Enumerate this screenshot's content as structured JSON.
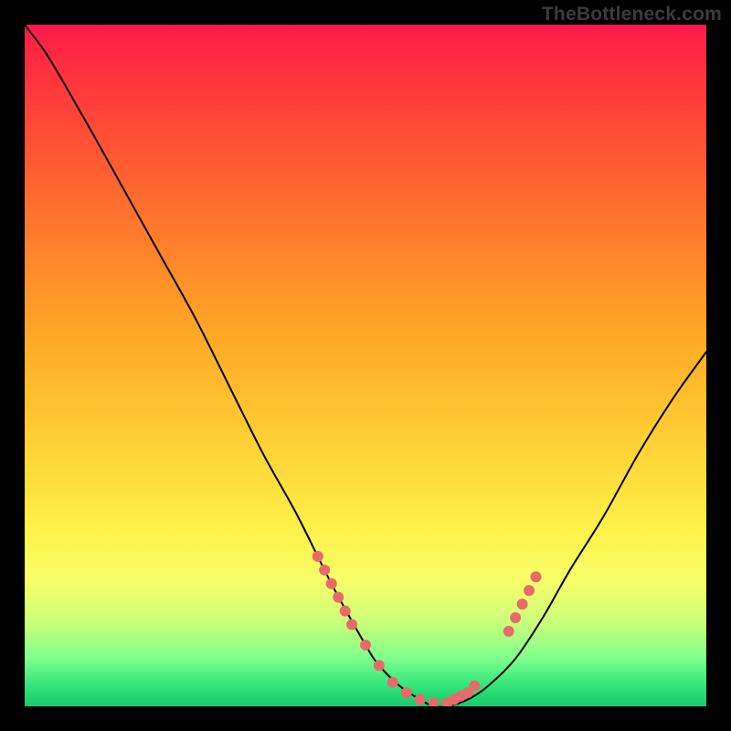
{
  "watermark": "TheBottleneck.com",
  "colors": {
    "background": "#000000",
    "gradient_top": "#ff1a4a",
    "gradient_bottom": "#17c96a",
    "curve": "#000000",
    "dots": "#e86a6a"
  },
  "chart_data": {
    "type": "line",
    "title": "",
    "xlabel": "",
    "ylabel": "",
    "xlim": [
      0,
      100
    ],
    "ylim": [
      0,
      100
    ],
    "x": [
      0,
      3,
      6,
      10,
      15,
      20,
      25,
      30,
      35,
      40,
      45,
      50,
      52,
      55,
      58,
      60,
      62,
      65,
      68,
      72,
      76,
      80,
      85,
      90,
      95,
      100
    ],
    "values": [
      100,
      96,
      91,
      84,
      75,
      66,
      57,
      47,
      37,
      28,
      18,
      9,
      6,
      3,
      1,
      0,
      0,
      1,
      3,
      7,
      13,
      20,
      28,
      37,
      45,
      52
    ],
    "dots_x": [
      43,
      44,
      45,
      46,
      47,
      48,
      50,
      52,
      54,
      56,
      58,
      60,
      62,
      63,
      64,
      65,
      66,
      71,
      72,
      73,
      74,
      75
    ],
    "dots_y": [
      22,
      20,
      18,
      16,
      14,
      12,
      9,
      6,
      3.5,
      2,
      1,
      0.5,
      0.5,
      1,
      1.5,
      2,
      3,
      11,
      13,
      15,
      17,
      19
    ]
  }
}
